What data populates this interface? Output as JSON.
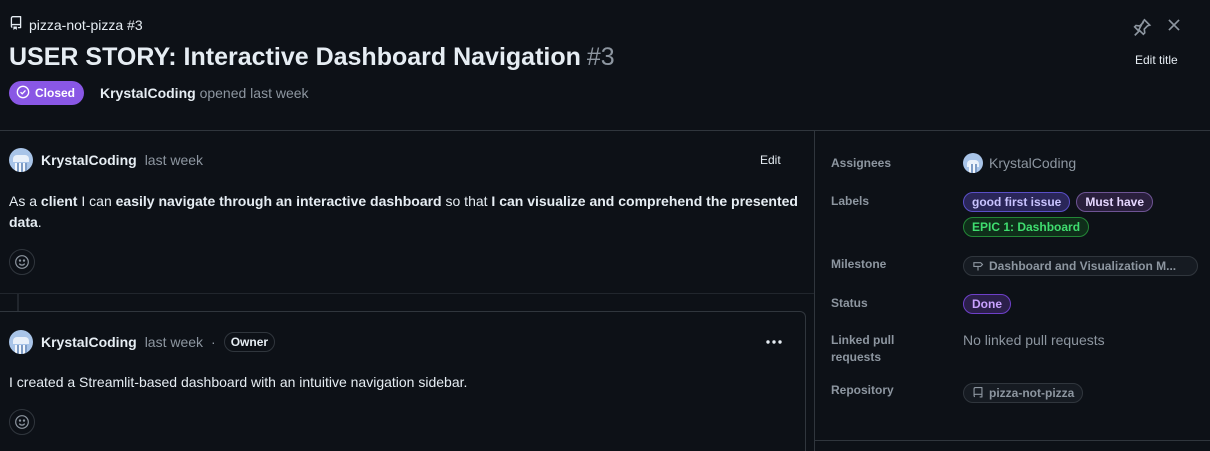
{
  "header": {
    "repo_ref": "pizza-not-pizza #3",
    "title": "USER STORY: Interactive Dashboard Navigation",
    "issue_number": "#3",
    "state": "Closed",
    "state_color": "#8957e5",
    "opened_by": "KrystalCoding",
    "opened_when": "opened last week",
    "edit_title_label": "Edit title",
    "icons": [
      "repo-icon",
      "pin-icon",
      "close-icon",
      "closed-check-icon"
    ]
  },
  "comments": [
    {
      "author": "KrystalCoding",
      "time": "last week",
      "edit_label": "Edit",
      "body": {
        "p1": "As a ",
        "b1": "client",
        "p2": " I can ",
        "b2": "easily navigate through an interactive dashboard",
        "p3": " so that ",
        "b3": "I can visualize and comprehend the presented data",
        "p4": "."
      }
    },
    {
      "author": "KrystalCoding",
      "time": "last week",
      "separator": "·",
      "badge": "Owner",
      "body": "I created a Streamlit-based dashboard with an intuitive navigation sidebar."
    }
  ],
  "sidebar": {
    "assignees_label": "Assignees",
    "assignee": "KrystalCoding",
    "labels_label": "Labels",
    "labels": [
      "good first issue",
      "Must have",
      "EPIC 1: Dashboard"
    ],
    "milestone_label": "Milestone",
    "milestone": "Dashboard and Visualization M...",
    "status_label": "Status",
    "status": "Done",
    "linked_label_1": "Linked pull",
    "linked_label_2": "requests",
    "linked_value": "No linked pull requests",
    "repository_label": "Repository",
    "repository": "pizza-not-pizza"
  }
}
